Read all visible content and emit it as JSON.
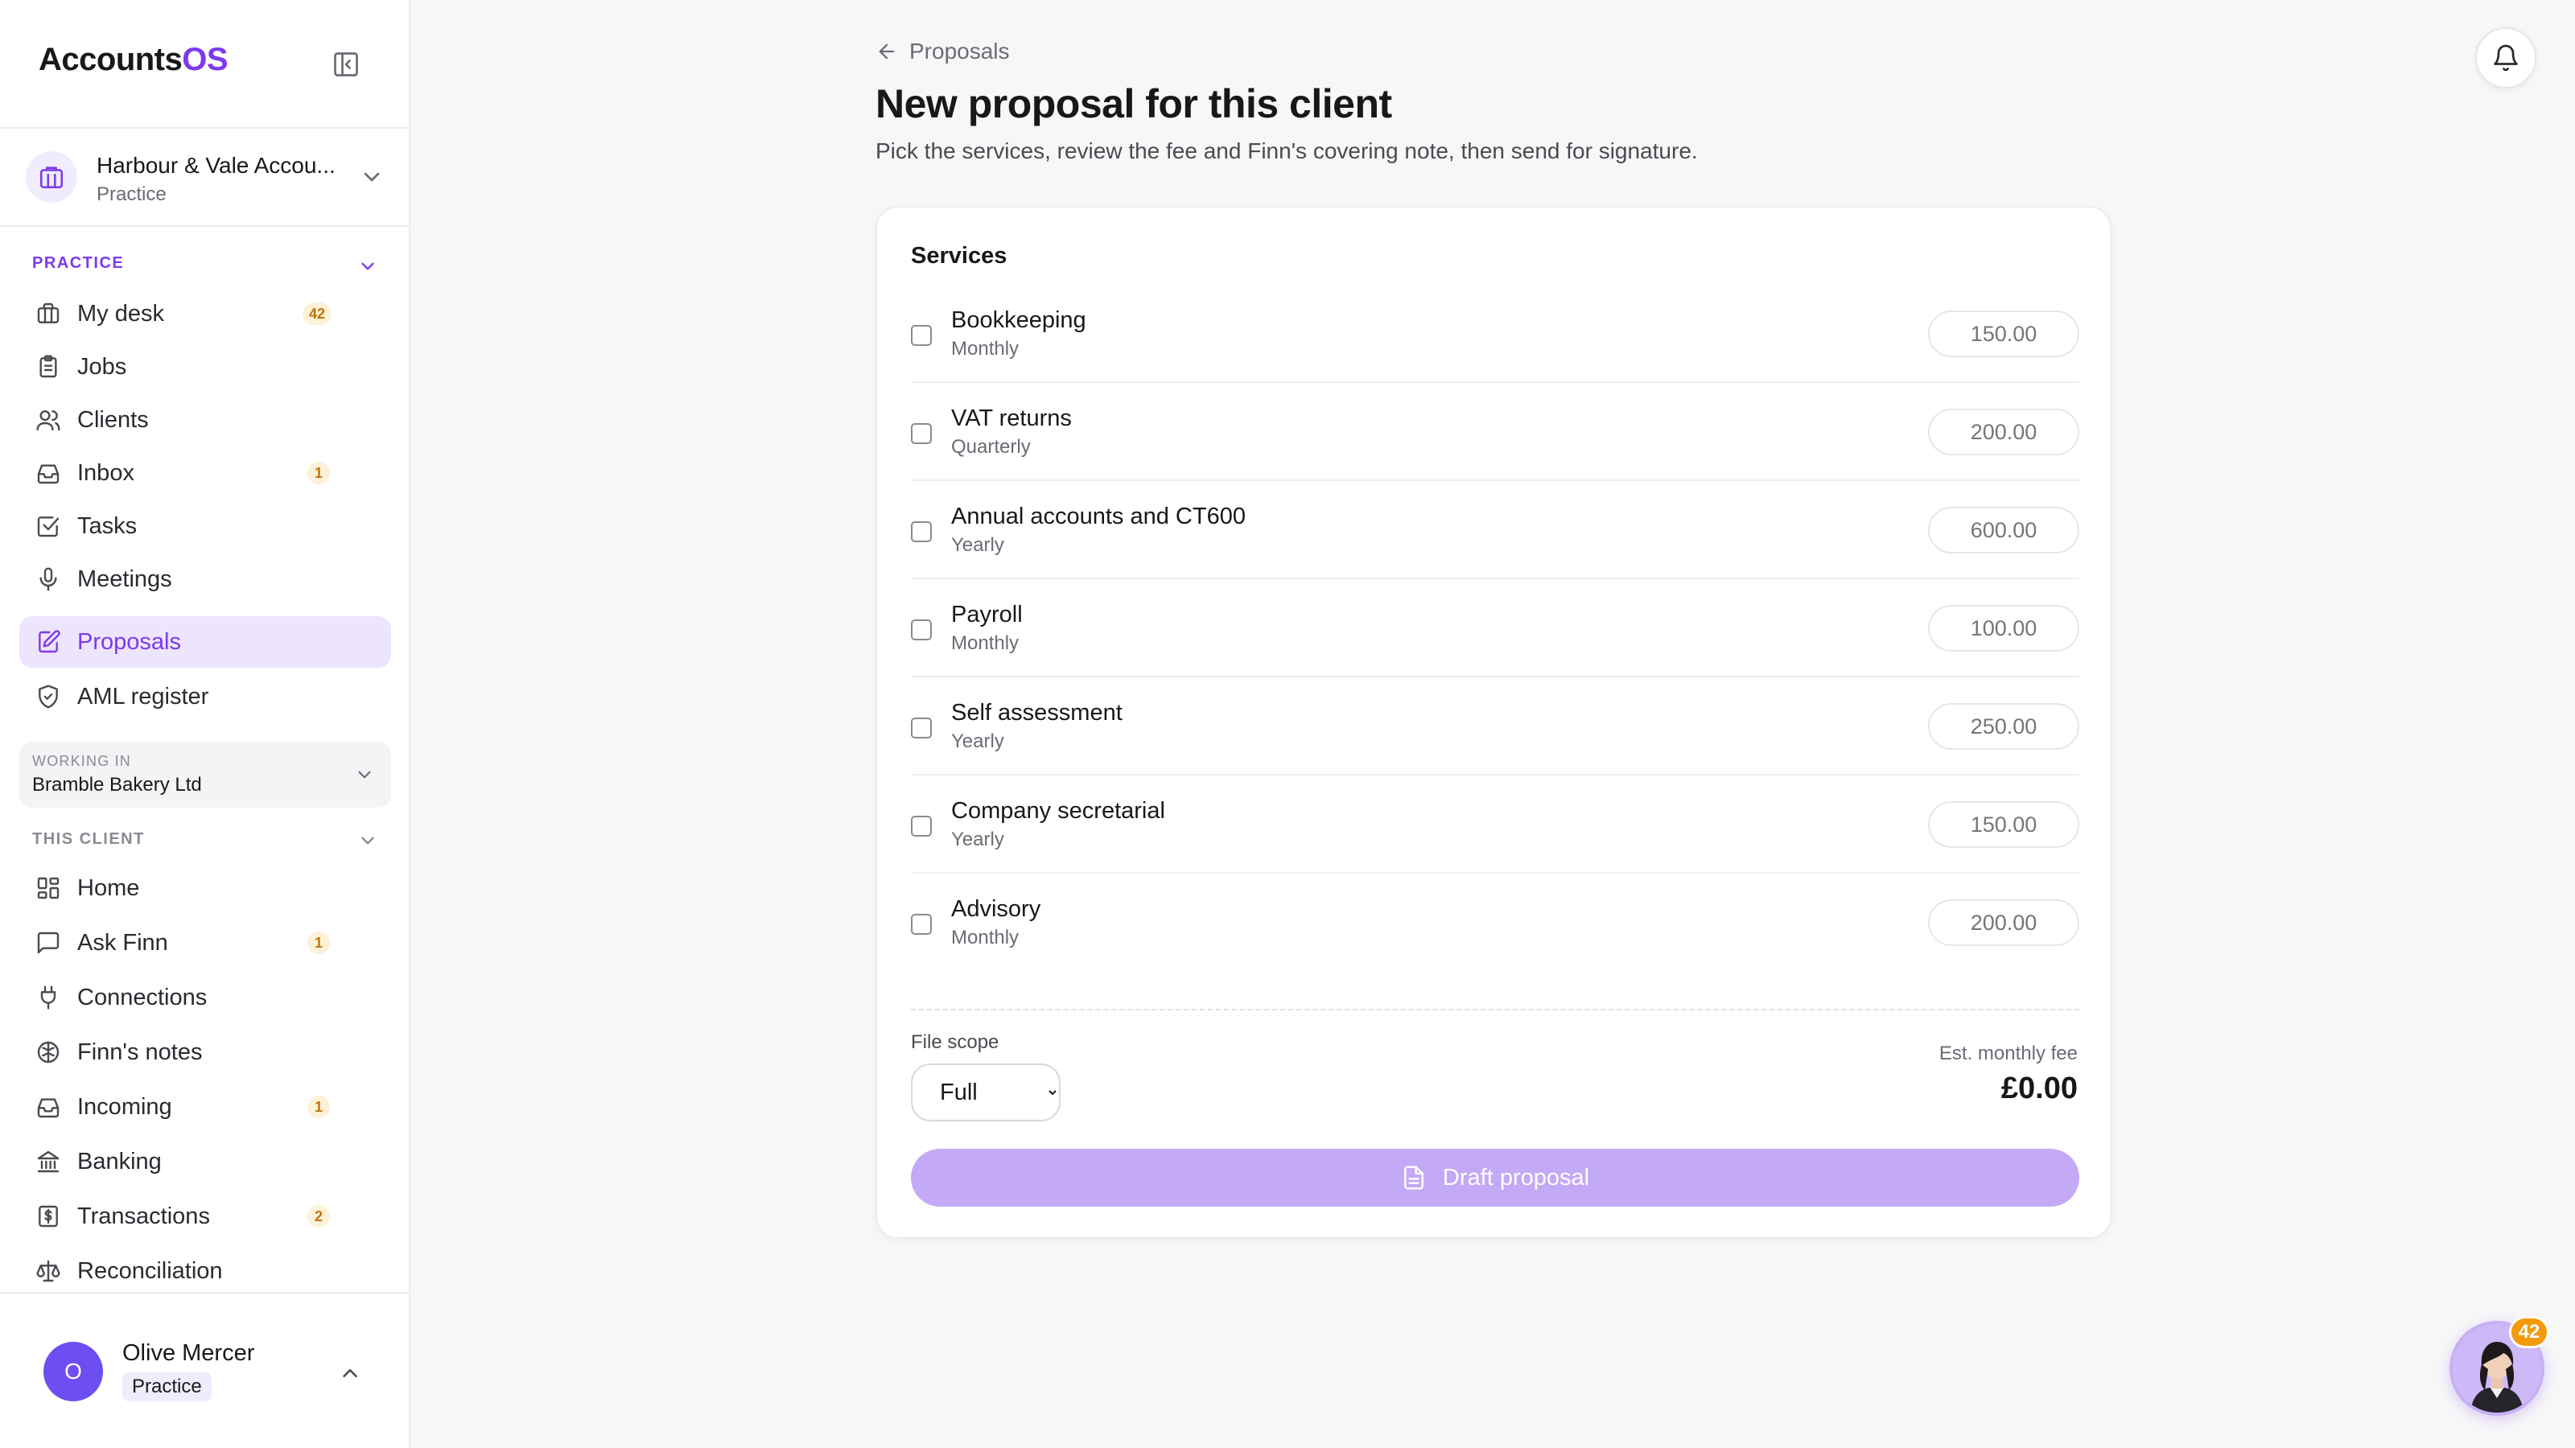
{
  "app": {
    "logo_main": "Accounts",
    "logo_accent": "OS"
  },
  "practice": {
    "name": "Harbour & Vale Accou...",
    "type": "Practice"
  },
  "practice_section": {
    "title": "PRACTICE",
    "items": [
      {
        "label": "My desk",
        "badge": "42",
        "icon": "briefcase-icon"
      },
      {
        "label": "Jobs",
        "badge": "",
        "icon": "clipboard-icon"
      },
      {
        "label": "Clients",
        "badge": "",
        "icon": "users-icon"
      },
      {
        "label": "Inbox",
        "badge": "1",
        "icon": "inbox-icon"
      },
      {
        "label": "Tasks",
        "badge": "",
        "icon": "checkbox-icon"
      },
      {
        "label": "Meetings",
        "badge": "",
        "icon": "microphone-icon"
      },
      {
        "label": "Proposals",
        "badge": "",
        "icon": "edit-document-icon",
        "active": true
      },
      {
        "label": "AML register",
        "badge": "",
        "icon": "shield-icon"
      }
    ]
  },
  "working_in": {
    "label": "WORKING IN",
    "value": "Bramble Bakery Ltd"
  },
  "client_section": {
    "title": "THIS CLIENT",
    "items": [
      {
        "label": "Home",
        "badge": "",
        "icon": "grid-icon"
      },
      {
        "label": "Ask Finn",
        "badge": "1",
        "icon": "chat-icon"
      },
      {
        "label": "Connections",
        "badge": "",
        "icon": "plug-icon"
      },
      {
        "label": "Finn's notes",
        "badge": "",
        "icon": "brain-icon"
      },
      {
        "label": "Incoming",
        "badge": "1",
        "icon": "inbox-icon"
      },
      {
        "label": "Banking",
        "badge": "",
        "icon": "bank-icon"
      },
      {
        "label": "Transactions",
        "badge": "2",
        "icon": "receipt-icon"
      },
      {
        "label": "Reconciliation",
        "badge": "",
        "icon": "scales-icon"
      }
    ]
  },
  "user": {
    "initial": "O",
    "name": "Olive Mercer",
    "role": "Practice"
  },
  "breadcrumb": {
    "label": "Proposals"
  },
  "page": {
    "title": "New proposal for this client",
    "subtitle": "Pick the services, review the fee and Finn's covering note, then send for signature."
  },
  "services": {
    "title": "Services",
    "currency": "£",
    "items": [
      {
        "name": "Bookkeeping",
        "frequency": "Monthly",
        "price": "150.00"
      },
      {
        "name": "VAT returns",
        "frequency": "Quarterly",
        "price": "200.00"
      },
      {
        "name": "Annual accounts and CT600",
        "frequency": "Yearly",
        "price": "600.00"
      },
      {
        "name": "Payroll",
        "frequency": "Monthly",
        "price": "100.00"
      },
      {
        "name": "Self assessment",
        "frequency": "Yearly",
        "price": "250.00"
      },
      {
        "name": "Company secretarial",
        "frequency": "Yearly",
        "price": "150.00"
      },
      {
        "name": "Advisory",
        "frequency": "Monthly",
        "price": "200.00"
      }
    ]
  },
  "file_scope": {
    "label": "File scope",
    "value": "Full"
  },
  "fee": {
    "label": "Est. monthly fee",
    "value": "£0.00"
  },
  "draft_button": {
    "label": "Draft proposal"
  },
  "assistant": {
    "badge": "42"
  },
  "colors": {
    "accent": "#7c3aed",
    "active_bg": "#ede5fd",
    "badge_bg": "#fdf1d8",
    "badge_text": "#c2730b",
    "button_disabled": "#c4a9f7"
  }
}
